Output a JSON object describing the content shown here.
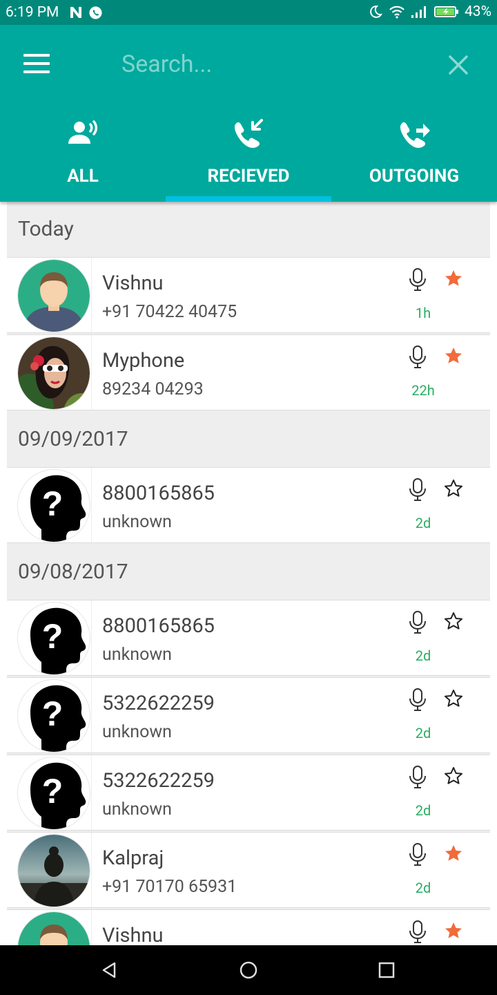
{
  "status_bar": {
    "time": "6:19 PM",
    "battery": "43%"
  },
  "search": {
    "placeholder": "Search..."
  },
  "tabs": [
    {
      "label": "ALL",
      "icon": "voice-user-icon",
      "active": false
    },
    {
      "label": "RECIEVED",
      "icon": "incoming-call-icon",
      "active": true
    },
    {
      "label": "OUTGOING",
      "icon": "outgoing-call-icon",
      "active": false
    }
  ],
  "sections": [
    {
      "date": "Today",
      "calls": [
        {
          "name": "Vishnu",
          "number": "+91 70422 40475",
          "time_ago": "1h",
          "starred": true,
          "avatar": "male-avatar"
        },
        {
          "name": "Myphone",
          "number": "89234 04293",
          "time_ago": "22h",
          "starred": true,
          "avatar": "photo-woman"
        }
      ]
    },
    {
      "date": "09/09/2017",
      "calls": [
        {
          "name": "8800165865",
          "number": "unknown",
          "time_ago": "2d",
          "starred": false,
          "avatar": "unknown-caller"
        }
      ]
    },
    {
      "date": "09/08/2017",
      "calls": [
        {
          "name": "8800165865",
          "number": "unknown",
          "time_ago": "2d",
          "starred": false,
          "avatar": "unknown-caller"
        },
        {
          "name": "5322622259",
          "number": "unknown",
          "time_ago": "2d",
          "starred": false,
          "avatar": "unknown-caller"
        },
        {
          "name": "5322622259",
          "number": "unknown",
          "time_ago": "2d",
          "starred": false,
          "avatar": "unknown-caller"
        },
        {
          "name": "Kalpraj",
          "number": "+91 70170 65931",
          "time_ago": "2d",
          "starred": true,
          "avatar": "photo-silhouette"
        },
        {
          "name": "Vishnu",
          "number": "",
          "time_ago": "",
          "starred": true,
          "avatar": "male-avatar"
        }
      ]
    }
  ],
  "colors": {
    "primary": "#00a99d",
    "status_bar": "#00897b",
    "tab_indicator": "#00c0e0",
    "star_active": "#f26b3a",
    "time_ago": "#27ae60"
  }
}
